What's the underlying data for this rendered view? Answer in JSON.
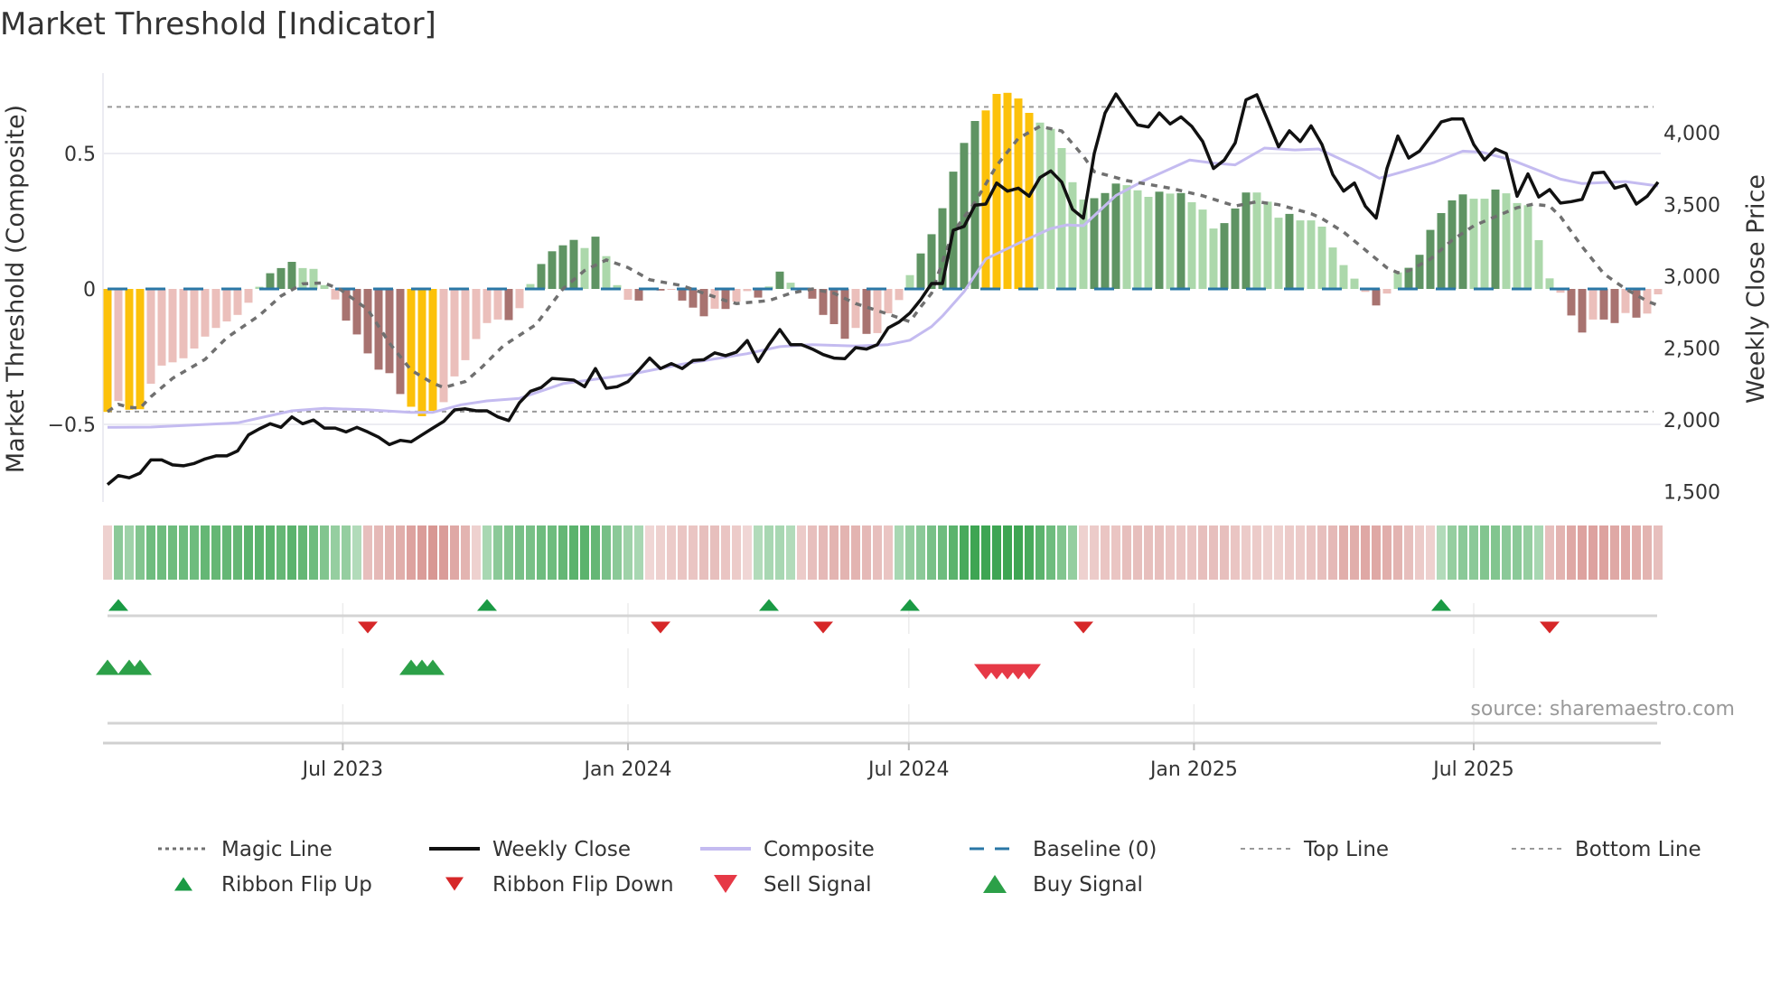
{
  "title": "Market Threshold [Indicator]",
  "source": "source: sharemaestro.com",
  "colors": {
    "bar_green_dark": "#5f9463",
    "bar_green_light": "#acd8ab",
    "bar_red_dark": "#a87370",
    "bar_red_light": "#ebbfbb",
    "bar_extreme": "#fcc10a",
    "magic": "#707070",
    "close": "#111111",
    "composite": "#c4bbf0",
    "baseline": "#2a77a6",
    "threshold_lines": "#999999",
    "ribbon_green": "#3ea553",
    "ribbon_red": "#d48b87",
    "flip_up": "#1a9a44",
    "flip_down": "#d62728",
    "sell": "#e63946",
    "buy": "#2ca048"
  },
  "chart_data": {
    "type": "bar+line",
    "title": "Market Threshold [Indicator]",
    "ylabel_left": "Market Threshold (Composite)",
    "ylabel_right": "Weekly Close Price",
    "x_unit": "week index",
    "x_range": [
      0,
      143
    ],
    "ylim_left": [
      -0.8,
      0.8
    ],
    "left_ticks": [
      {
        "v": 0.5,
        "label": "0.5"
      },
      {
        "v": 0,
        "label": "0"
      },
      {
        "v": -0.5,
        "label": "−0.5"
      }
    ],
    "right_ticks": [
      {
        "v": 4000,
        "label": "4,000"
      },
      {
        "v": 3500,
        "label": "3,500"
      },
      {
        "v": 3000,
        "label": "3,000"
      },
      {
        "v": 2500,
        "label": "2,500"
      },
      {
        "v": 2000,
        "label": "2,000"
      },
      {
        "v": 1500,
        "label": "1,500"
      }
    ],
    "x_ticks": [
      {
        "x": 21.7,
        "label": "Jul 2023"
      },
      {
        "x": 48,
        "label": "Jan 2024"
      },
      {
        "x": 73.9,
        "label": "Jul 2024"
      },
      {
        "x": 100.2,
        "label": "Jan 2025"
      },
      {
        "x": 126,
        "label": "Jul 2025"
      }
    ],
    "top_line": 0.672,
    "bottom_line": -0.453,
    "extreme_upper": 0.645,
    "extreme_lower": -0.43,
    "composite_bars": [
      -0.454,
      -0.414,
      -0.446,
      -0.444,
      -0.35,
      -0.283,
      -0.271,
      -0.256,
      -0.22,
      -0.176,
      -0.144,
      -0.12,
      -0.096,
      -0.051,
      0.008,
      0.058,
      0.077,
      0.1,
      0.077,
      0.074,
      0.014,
      -0.039,
      -0.117,
      -0.168,
      -0.238,
      -0.298,
      -0.311,
      -0.388,
      -0.435,
      -0.47,
      -0.45,
      -0.418,
      -0.323,
      -0.263,
      -0.185,
      -0.126,
      -0.113,
      -0.115,
      -0.071,
      0.018,
      0.092,
      0.139,
      0.161,
      0.181,
      0.151,
      0.193,
      0.121,
      0.014,
      -0.04,
      -0.043,
      -0.004,
      -0.006,
      -0.003,
      -0.043,
      -0.069,
      -0.101,
      -0.073,
      -0.074,
      -0.047,
      -0.008,
      -0.032,
      0.009,
      0.064,
      0.023,
      -0.002,
      -0.036,
      -0.096,
      -0.13,
      -0.184,
      -0.144,
      -0.166,
      -0.163,
      -0.09,
      -0.041,
      0.051,
      0.131,
      0.202,
      0.298,
      0.433,
      0.539,
      0.62,
      0.659,
      0.72,
      0.724,
      0.703,
      0.65,
      0.614,
      0.591,
      0.52,
      0.394,
      0.33,
      0.335,
      0.354,
      0.389,
      0.383,
      0.364,
      0.34,
      0.359,
      0.352,
      0.354,
      0.32,
      0.293,
      0.223,
      0.243,
      0.297,
      0.356,
      0.356,
      0.322,
      0.263,
      0.277,
      0.253,
      0.253,
      0.23,
      0.153,
      0.088,
      0.038,
      -0.011,
      -0.061,
      -0.017,
      0.061,
      0.078,
      0.126,
      0.218,
      0.28,
      0.327,
      0.349,
      0.333,
      0.333,
      0.367,
      0.353,
      0.317,
      0.309,
      0.18,
      0.039,
      -0.014,
      -0.098,
      -0.161,
      -0.113,
      -0.113,
      -0.126,
      -0.089,
      -0.106,
      -0.091,
      -0.02
    ],
    "weekly_close": [
      1549,
      1612,
      1596,
      1629,
      1721,
      1721,
      1686,
      1680,
      1696,
      1728,
      1749,
      1749,
      1784,
      1895,
      1937,
      1973,
      1948,
      2021,
      1973,
      1999,
      1943,
      1943,
      1916,
      1948,
      1916,
      1879,
      1828,
      1857,
      1847,
      1895,
      1943,
      1989,
      2069,
      2077,
      2063,
      2063,
      2021,
      1995,
      2120,
      2199,
      2225,
      2289,
      2283,
      2277,
      2231,
      2357,
      2220,
      2231,
      2266,
      2346,
      2430,
      2357,
      2392,
      2357,
      2413,
      2419,
      2467,
      2447,
      2472,
      2552,
      2405,
      2524,
      2629,
      2524,
      2524,
      2493,
      2455,
      2430,
      2426,
      2503,
      2493,
      2524,
      2640,
      2681,
      2744,
      2838,
      2950,
      2950,
      3321,
      3348,
      3495,
      3503,
      3650,
      3593,
      3614,
      3558,
      3688,
      3734,
      3656,
      3467,
      3405,
      3855,
      4138,
      4270,
      4159,
      4054,
      4040,
      4138,
      4061,
      4111,
      4044,
      3939,
      3751,
      3810,
      3929,
      4229,
      4264,
      4086,
      3902,
      4013,
      3939,
      4048,
      3918,
      3709,
      3593,
      3650,
      3489,
      3405,
      3751,
      3977,
      3824,
      3872,
      3971,
      4075,
      4096,
      4096,
      3918,
      3810,
      3887,
      3855,
      3558,
      3713,
      3552,
      3604,
      3510,
      3520,
      3536,
      3719,
      3725,
      3614,
      3635,
      3503,
      3558,
      3656
    ],
    "composite_line": [
      [
        0,
        1948
      ],
      [
        4,
        1950
      ],
      [
        12,
        1979
      ],
      [
        17,
        2063
      ],
      [
        20,
        2080
      ],
      [
        24,
        2070
      ],
      [
        28,
        2052
      ],
      [
        30,
        2052
      ],
      [
        32.6,
        2105
      ],
      [
        35,
        2132
      ],
      [
        38,
        2150
      ],
      [
        42,
        2252
      ],
      [
        48,
        2314
      ],
      [
        53,
        2388
      ],
      [
        59,
        2461
      ],
      [
        62,
        2510
      ],
      [
        65,
        2524
      ],
      [
        69,
        2514
      ],
      [
        72,
        2524
      ],
      [
        74,
        2555
      ],
      [
        76,
        2650
      ],
      [
        77,
        2723
      ],
      [
        79,
        2893
      ],
      [
        81,
        3121
      ],
      [
        84.5,
        3247
      ],
      [
        87,
        3333
      ],
      [
        88.5,
        3358
      ],
      [
        90,
        3352
      ],
      [
        93,
        3562
      ],
      [
        95.6,
        3667
      ],
      [
        99.8,
        3810
      ],
      [
        102,
        3789
      ],
      [
        104,
        3776
      ],
      [
        106.7,
        3893
      ],
      [
        109.5,
        3880
      ],
      [
        111.7,
        3887
      ],
      [
        115.6,
        3751
      ],
      [
        117.3,
        3683
      ],
      [
        119.5,
        3729
      ],
      [
        122.3,
        3792
      ],
      [
        125,
        3872
      ],
      [
        126.7,
        3865
      ],
      [
        129.5,
        3810
      ],
      [
        134,
        3677
      ],
      [
        136,
        3646
      ],
      [
        140,
        3660
      ],
      [
        143,
        3629
      ]
    ],
    "magic_line": [
      [
        0,
        -0.453
      ],
      [
        1,
        -0.426
      ],
      [
        2,
        -0.437
      ],
      [
        3,
        -0.44
      ],
      [
        4,
        -0.398
      ],
      [
        6,
        -0.33
      ],
      [
        9,
        -0.26
      ],
      [
        11,
        -0.18
      ],
      [
        14,
        -0.098
      ],
      [
        16,
        -0.026
      ],
      [
        18,
        0.019
      ],
      [
        20,
        0.022
      ],
      [
        21.5,
        -0.003
      ],
      [
        24,
        -0.076
      ],
      [
        26,
        -0.2
      ],
      [
        28,
        -0.3
      ],
      [
        30,
        -0.348
      ],
      [
        31,
        -0.364
      ],
      [
        33,
        -0.342
      ],
      [
        34.5,
        -0.29
      ],
      [
        36.5,
        -0.21
      ],
      [
        39.5,
        -0.132
      ],
      [
        42,
        0
      ],
      [
        44,
        0.068
      ],
      [
        46,
        0.107
      ],
      [
        48,
        0.079
      ],
      [
        50,
        0.034
      ],
      [
        53,
        0.012
      ],
      [
        55,
        -0.016
      ],
      [
        57,
        -0.043
      ],
      [
        58,
        -0.054
      ],
      [
        61,
        -0.043
      ],
      [
        63,
        -0.016
      ],
      [
        65,
        0
      ],
      [
        67,
        -0.016
      ],
      [
        69,
        -0.054
      ],
      [
        72,
        -0.093
      ],
      [
        74,
        -0.121
      ],
      [
        75,
        -0.066
      ],
      [
        76,
        -0.016
      ],
      [
        77,
        0.1
      ],
      [
        78,
        0.21
      ],
      [
        80,
        0.32
      ],
      [
        82,
        0.455
      ],
      [
        84,
        0.556
      ],
      [
        86,
        0.6
      ],
      [
        88,
        0.583
      ],
      [
        90,
        0.49
      ],
      [
        91,
        0.433
      ],
      [
        94,
        0.4
      ],
      [
        98,
        0.372
      ],
      [
        101,
        0.344
      ],
      [
        104,
        0.306
      ],
      [
        106,
        0.322
      ],
      [
        108,
        0.311
      ],
      [
        111,
        0.278
      ],
      [
        112,
        0.26
      ],
      [
        114,
        0.21
      ],
      [
        116,
        0.144
      ],
      [
        118,
        0.078
      ],
      [
        119,
        0.06
      ],
      [
        120,
        0.067
      ],
      [
        122,
        0.11
      ],
      [
        124,
        0.18
      ],
      [
        126,
        0.233
      ],
      [
        128,
        0.267
      ],
      [
        130,
        0.3
      ],
      [
        131.5,
        0.313
      ],
      [
        133,
        0.306
      ],
      [
        134,
        0.267
      ],
      [
        136,
        0.156
      ],
      [
        138,
        0.056
      ],
      [
        140,
        0
      ],
      [
        142,
        -0.045
      ],
      [
        143,
        -0.061
      ]
    ],
    "ribbon": [
      -0.15,
      0.35,
      0.25,
      0.4,
      0.5,
      0.5,
      0.5,
      0.5,
      0.5,
      0.55,
      0.55,
      0.55,
      0.55,
      0.6,
      0.6,
      0.6,
      0.55,
      0.6,
      0.55,
      0.5,
      0.4,
      0.3,
      0.3,
      0.15,
      -0.3,
      -0.35,
      -0.4,
      -0.45,
      -0.55,
      -0.6,
      -0.65,
      -0.6,
      -0.5,
      -0.4,
      -0.15,
      0.2,
      0.35,
      0.4,
      0.45,
      0.45,
      0.5,
      0.5,
      0.55,
      0.6,
      0.6,
      0.55,
      0.45,
      0.35,
      0.25,
      0.2,
      -0.1,
      -0.15,
      -0.2,
      -0.25,
      -0.25,
      -0.3,
      -0.3,
      -0.25,
      -0.2,
      -0.1,
      0.15,
      0.2,
      0.2,
      0.15,
      -0.2,
      -0.3,
      -0.35,
      -0.4,
      -0.4,
      -0.4,
      -0.35,
      -0.3,
      -0.25,
      0.2,
      0.3,
      0.35,
      0.45,
      0.5,
      0.6,
      0.7,
      0.8,
      0.85,
      0.9,
      0.85,
      0.8,
      0.7,
      0.6,
      0.5,
      0.4,
      0.3,
      -0.15,
      -0.2,
      -0.25,
      -0.25,
      -0.3,
      -0.3,
      -0.3,
      -0.3,
      -0.25,
      -0.25,
      -0.25,
      -0.3,
      -0.3,
      -0.3,
      -0.25,
      -0.2,
      -0.2,
      -0.15,
      -0.15,
      -0.2,
      -0.2,
      -0.25,
      -0.3,
      -0.35,
      -0.45,
      -0.45,
      -0.5,
      -0.5,
      -0.45,
      -0.4,
      -0.3,
      -0.2,
      -0.15,
      0.15,
      0.3,
      0.35,
      0.35,
      0.4,
      0.4,
      0.35,
      0.35,
      0.3,
      0.2,
      -0.3,
      -0.4,
      -0.5,
      -0.55,
      -0.55,
      -0.55,
      -0.5,
      -0.5,
      -0.45,
      -0.4,
      -0.3
    ],
    "ribbon_flip_up": [
      1,
      35,
      61,
      74,
      123
    ],
    "ribbon_flip_down": [
      24,
      51,
      66,
      90,
      133
    ],
    "buy_signals": [
      0,
      2,
      3,
      28,
      29,
      30
    ],
    "sell_signals": [
      81,
      82,
      83,
      84,
      85
    ],
    "legend": [
      {
        "key": "magic",
        "label": "Magic Line"
      },
      {
        "key": "close",
        "label": "Weekly Close"
      },
      {
        "key": "composite",
        "label": "Composite"
      },
      {
        "key": "baseline",
        "label": "Baseline (0)"
      },
      {
        "key": "top",
        "label": "Top Line"
      },
      {
        "key": "bottom",
        "label": "Bottom Line"
      },
      {
        "key": "flip_up",
        "label": "Ribbon Flip Up"
      },
      {
        "key": "flip_down",
        "label": "Ribbon Flip Down"
      },
      {
        "key": "sell",
        "label": "Sell Signal"
      },
      {
        "key": "buy",
        "label": "Buy Signal"
      }
    ],
    "legend_placement": "bottom"
  }
}
